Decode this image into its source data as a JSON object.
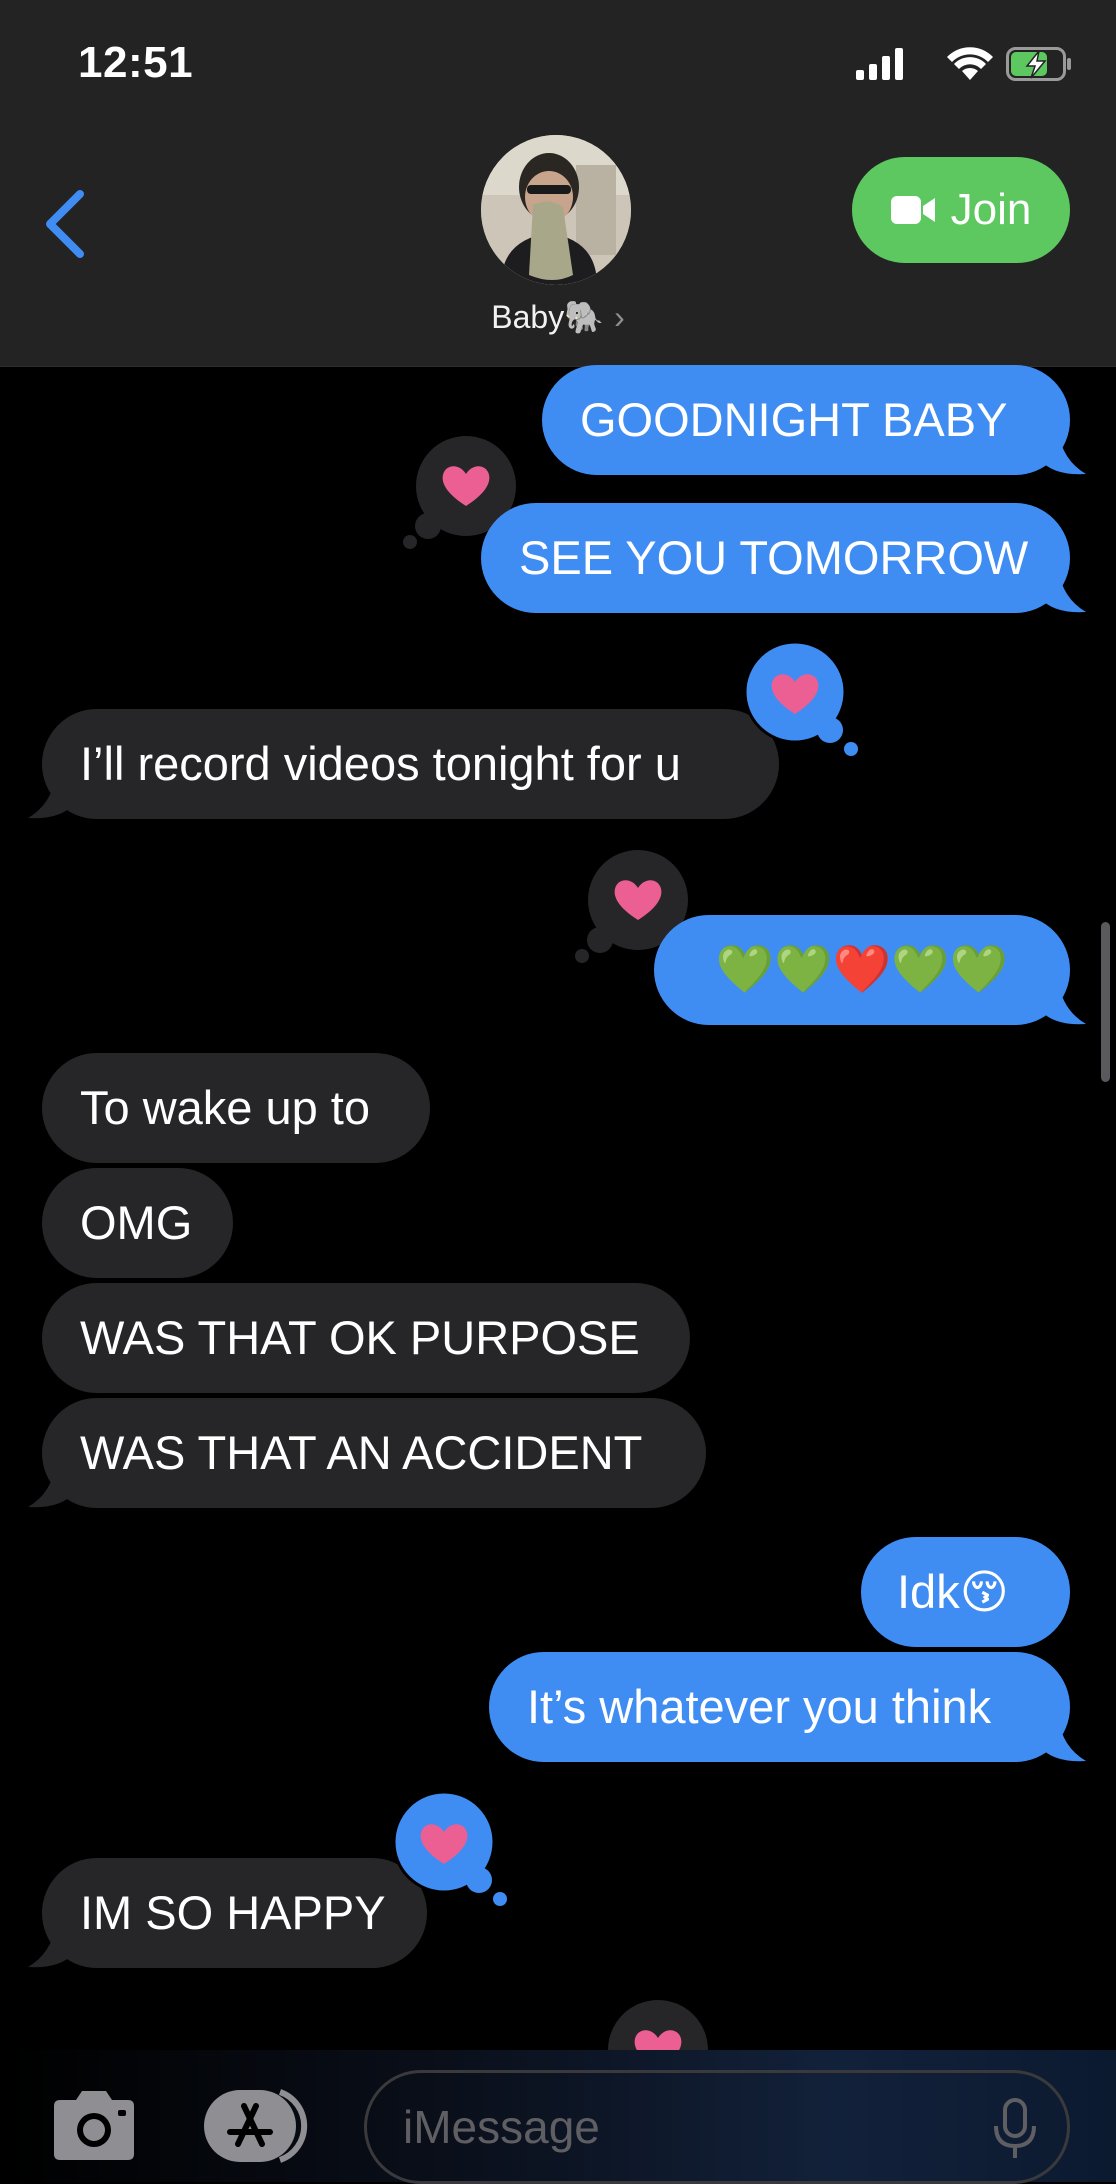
{
  "status_bar": {
    "time": "12:51"
  },
  "header": {
    "contact_name": "Baby🐘",
    "chevron": "›",
    "join_label": "Join"
  },
  "messages": [
    {
      "side": "sent",
      "text": "GOODNIGHT BABY"
    },
    {
      "side": "sent",
      "text": "SEE YOU TOMORROW",
      "tapback": "heart"
    },
    {
      "side": "received",
      "text": "I’ll record videos tonight for u",
      "tapback": "heart"
    },
    {
      "side": "sent",
      "text": "💚💚❤️💚💚",
      "tapback": "heart"
    },
    {
      "side": "received",
      "text": "To wake up to"
    },
    {
      "side": "received",
      "text": "OMG"
    },
    {
      "side": "received",
      "text": "WAS THAT OK PURPOSE"
    },
    {
      "side": "received",
      "text": "WAS THAT AN ACCIDENT"
    },
    {
      "side": "sent",
      "text": "Idk😚"
    },
    {
      "side": "sent",
      "text": "It’s whatever you think"
    },
    {
      "side": "received",
      "text": "IM SO HAPPY",
      "tapback": "heart"
    }
  ],
  "input": {
    "placeholder": "iMessage"
  },
  "colors": {
    "sent_bubble": "#3f8cf3",
    "received_bubble": "#262628",
    "join_button": "#5dc85f",
    "heart": "#ec5f93",
    "back_chevron": "#3f8cf3"
  },
  "icons": [
    "back-chevron-icon",
    "video-camera-icon",
    "camera-icon",
    "app-store-icon",
    "microphone-icon",
    "heart-icon",
    "signal-icon",
    "wifi-icon",
    "battery-charging-icon"
  ]
}
